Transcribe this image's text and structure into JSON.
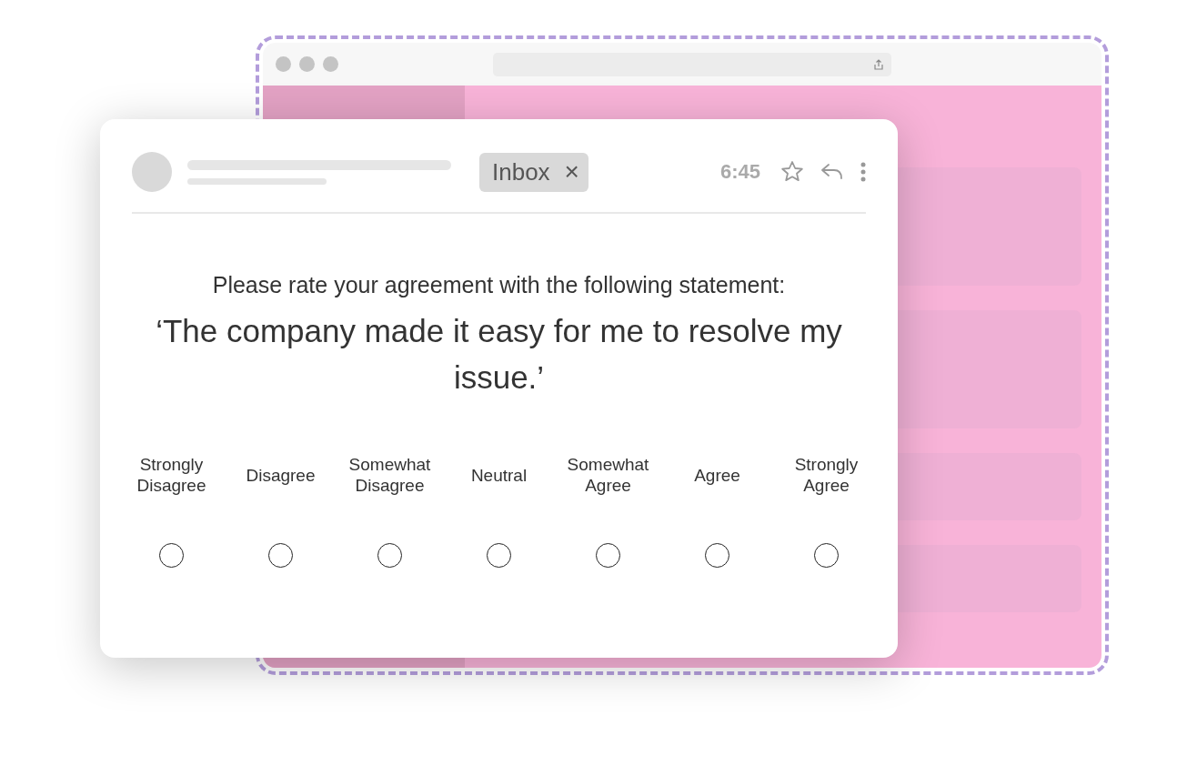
{
  "email": {
    "label_chip": {
      "text": "Inbox",
      "close": "×"
    },
    "time": "6:45"
  },
  "survey": {
    "prompt": "Please rate your agreement with the following statement:",
    "statement": "‘The company made it easy for me to resolve my issue.’",
    "options": [
      {
        "label": "Strongly Disagree",
        "selected": false
      },
      {
        "label": "Disagree",
        "selected": false
      },
      {
        "label": "Somewhat Disagree",
        "selected": false
      },
      {
        "label": "Neutral",
        "selected": false
      },
      {
        "label": "Somewhat Agree",
        "selected": false
      },
      {
        "label": "Agree",
        "selected": false
      },
      {
        "label": "Strongly Agree",
        "selected": false
      }
    ]
  }
}
